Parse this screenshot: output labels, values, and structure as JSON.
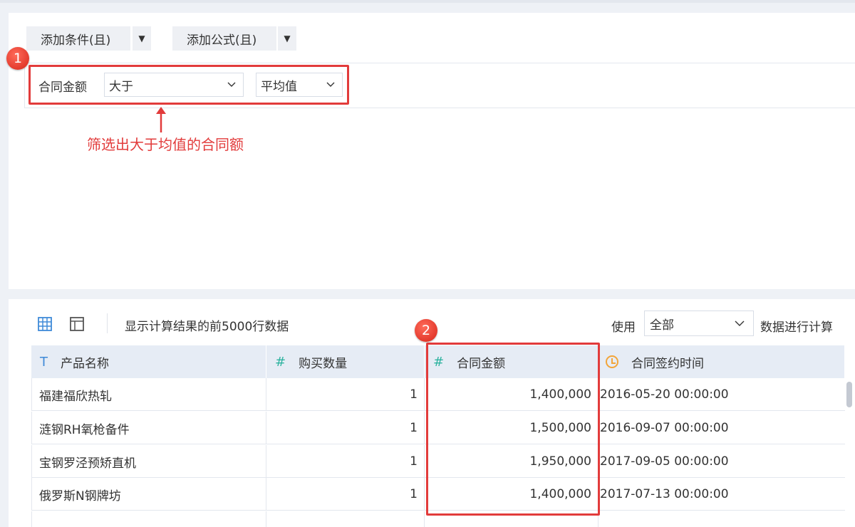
{
  "toolbar": {
    "add_condition_label": "添加条件(且)",
    "add_formula_label": "添加公式(且)"
  },
  "condition": {
    "field_label": "合同金额",
    "operator_value": "大于",
    "value_value": "平均值"
  },
  "annotations": {
    "badge1": "1",
    "badge2": "2",
    "note": "筛选出大于均值的合同额"
  },
  "preview": {
    "hint": "显示计算结果的前5000行数据",
    "use_label": "使用",
    "scope_value": "全部",
    "calc_label": "数据进行计算"
  },
  "table": {
    "columns": [
      {
        "label": "产品名称",
        "type_icon": "T"
      },
      {
        "label": "购买数量",
        "type_icon": "#"
      },
      {
        "label": "合同金额",
        "type_icon": "#"
      },
      {
        "label": "合同签约时间",
        "type_icon": "clock-icon"
      }
    ],
    "rows": [
      [
        "福建福欣热轧",
        "1",
        "1,400,000",
        "2016-05-20 00:00:00"
      ],
      [
        "涟钢RH氧枪备件",
        "1",
        "1,500,000",
        "2016-09-07 00:00:00"
      ],
      [
        "宝钢罗泾预矫直机",
        "1",
        "1,950,000",
        "2017-09-05 00:00:00"
      ],
      [
        "俄罗斯N钢牌坊",
        "1",
        "1,400,000",
        "2017-07-13 00:00:00"
      ]
    ]
  },
  "colors": {
    "highlight": "#e23b3b",
    "header_bg": "#e6ecf5",
    "accent_blue": "#3f8ad8",
    "accent_teal": "#2fb3a0",
    "accent_orange": "#f2a53a"
  }
}
